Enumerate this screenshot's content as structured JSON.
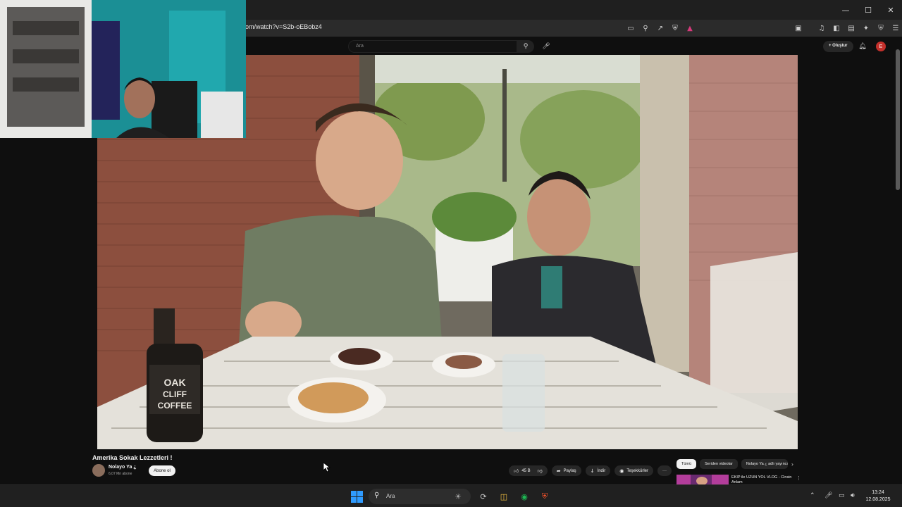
{
  "browser": {
    "url": "om/watch?v=S2b-oEBobz4",
    "window_controls": {
      "minimize": "—",
      "maximize": "☐",
      "close": "✕"
    },
    "toolbar_icons": [
      "cast-icon",
      "zoom-icon",
      "share-icon",
      "shield-icon",
      "rewards-icon"
    ],
    "right_icons": [
      "screenshot-icon",
      "media-icon",
      "sidebar-icon",
      "wallet-icon",
      "leo-icon",
      "vpn-icon",
      "menu-icon"
    ]
  },
  "youtube": {
    "search_placeholder": "Ara",
    "create_label": "+ Oluştur",
    "avatar_letter": "E",
    "video_title": "Amerika Sokak Lezzetleri !",
    "channel_name": "Nolayo Ya ¿",
    "channel_subs": "6,07 Mn abone",
    "subscribe_label": "Abone ol",
    "like_count": "45 B",
    "share_label": "Paylaş",
    "download_label": "İndir",
    "thanks_label": "Teşekkürler",
    "more_label": "···",
    "chips": [
      "Tümü",
      "Seriden videolar",
      "Nolayo Ya ¿ adlı yayıncı"
    ],
    "rec_title": "EKİP ile UZUN YOL VLOG - Cinsin Anlam"
  },
  "taskbar": {
    "search_label": "Ara",
    "time": "13:24",
    "date": "12.08.2025"
  },
  "colors": {
    "background": "#0f0f0f",
    "accent_red": "#c4302b",
    "windows_blue": "#2f9bff",
    "spotify_green": "#1db954"
  }
}
